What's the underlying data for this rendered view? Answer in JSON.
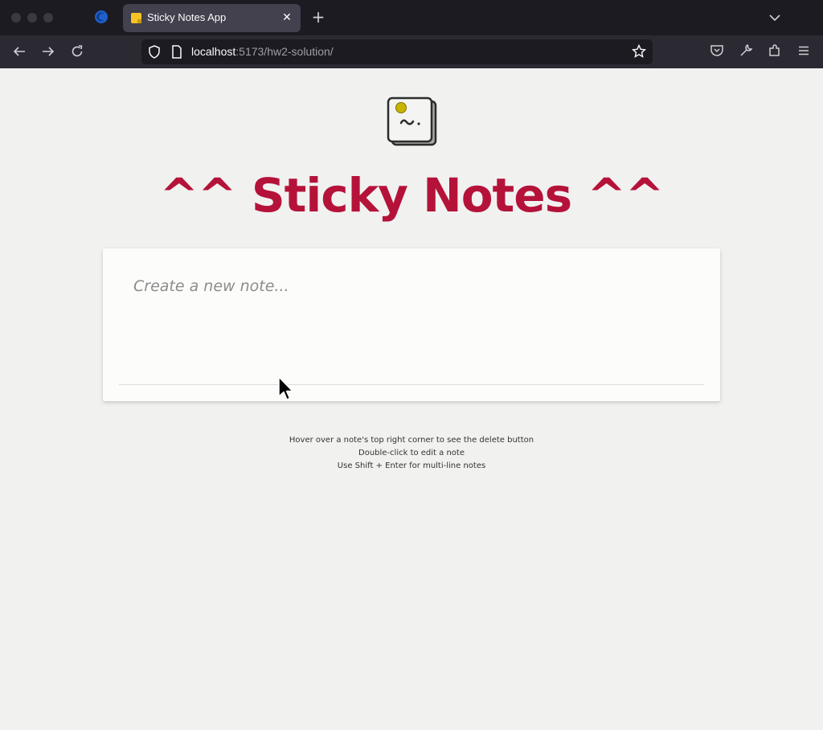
{
  "browser": {
    "tab_title": "Sticky Notes App",
    "url_host": "localhost",
    "url_rest": ":5173/hw2-solution/",
    "tab_close_glyph": "✕",
    "new_tab_glyph": "+",
    "icons": [
      "firefox-icon",
      "back-icon",
      "forward-icon",
      "reload-icon",
      "shield-icon",
      "page-icon",
      "bookmark-star-icon",
      "pocket-icon",
      "wrench-icon",
      "extensions-icon",
      "menu-icon",
      "chevron-down-icon"
    ]
  },
  "app": {
    "title": "^^ Sticky Notes ^^",
    "note_placeholder": "Create a new note...",
    "instructions": [
      "Hover over a note's top right corner to see the delete button",
      "Double-click to edit a note",
      "Use Shift + Enter for multi-line notes"
    ]
  },
  "colors": {
    "title": "#b5123a",
    "page_background": "#f1f1f0",
    "card_background": "#fcfcfb",
    "browser_chrome": "#1c1b22"
  }
}
